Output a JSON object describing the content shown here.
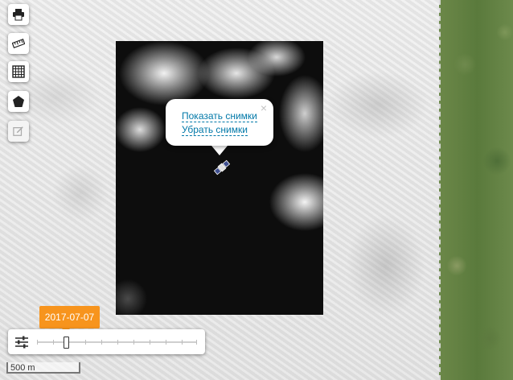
{
  "map": {
    "popup": {
      "close": "×",
      "show_images": "Показать снимки",
      "hide_images": "Убрать снимки"
    },
    "toolbar": [
      {
        "name": "print-icon"
      },
      {
        "name": "ruler-icon"
      },
      {
        "name": "grid-icon"
      },
      {
        "name": "polygon-icon"
      },
      {
        "name": "edit-icon",
        "disabled": true
      }
    ],
    "timeline": {
      "date": "2017-07-07",
      "position": 0.18
    },
    "scale": {
      "label": "500 m"
    }
  },
  "colors": {
    "accent": "#f7941d",
    "link": "#0078a8"
  }
}
